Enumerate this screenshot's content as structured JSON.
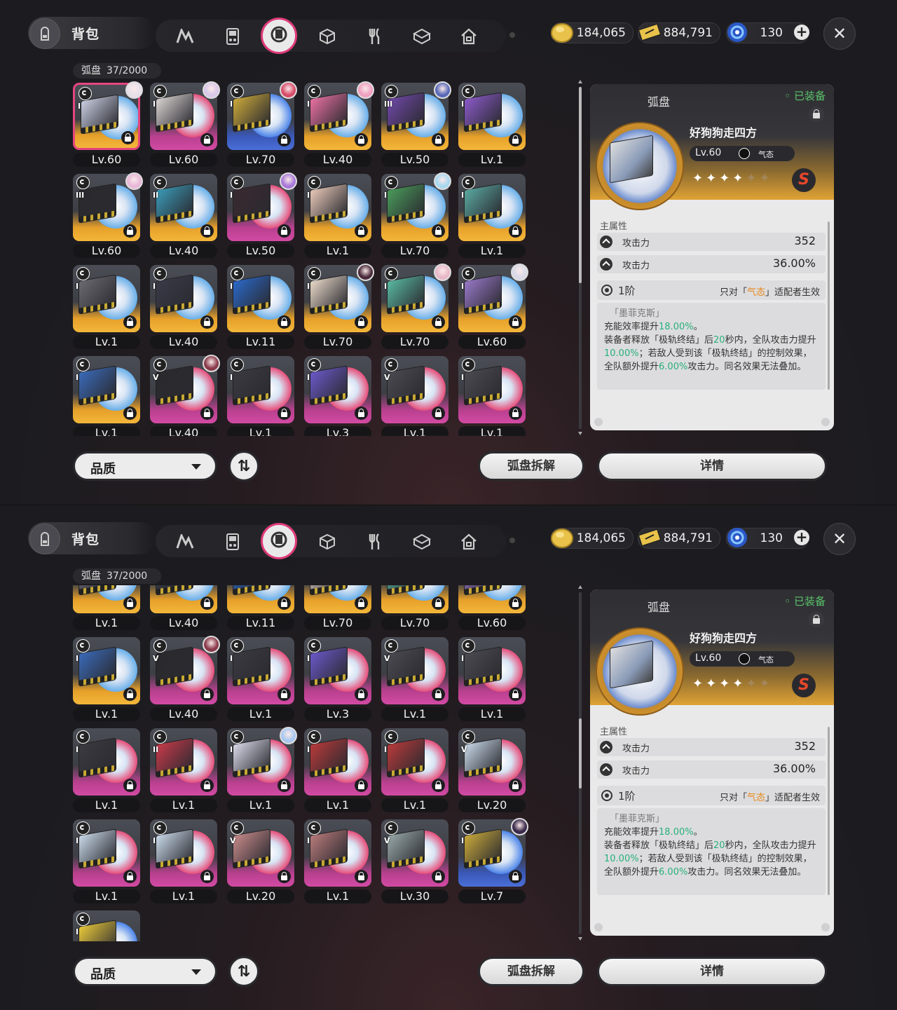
{
  "colors": {
    "selected_border": "#e5457f",
    "green": "#27b07a",
    "orange": "#e88a1a",
    "equipped": "#5ac26a"
  },
  "header": {
    "title": "背包",
    "nav_tabs": [
      "agents-icon",
      "gamepad-icon",
      "disc-icon",
      "cube-icon",
      "food-icon",
      "package-icon",
      "home-icon"
    ],
    "active_tab": "disc-icon",
    "currencies": [
      {
        "icon": "coin-icon",
        "value": "184,065"
      },
      {
        "icon": "ticket-icon",
        "value": "884,791"
      },
      {
        "icon": "energy-icon",
        "value": "130"
      }
    ]
  },
  "grid": {
    "label": "弧盘",
    "count": "37/2000"
  },
  "panel1": {
    "items": [
      {
        "lv": "Lv.60",
        "rank": "I",
        "rarity": "gold",
        "avatar": "#e8e0e8",
        "cover": "#c8cde0",
        "selected": true
      },
      {
        "lv": "Lv.60",
        "rank": "I",
        "rarity": "purple",
        "avatar": "#d8c8e8",
        "cover": "#d8d2d0"
      },
      {
        "lv": "Lv.70",
        "rank": "I",
        "rarity": "blue",
        "avatar": "#d84c6a",
        "cover": "#caa83a"
      },
      {
        "lv": "Lv.40",
        "rank": "I",
        "rarity": "gold",
        "avatar": "#f0a0c0",
        "cover": "#e870a0"
      },
      {
        "lv": "Lv.50",
        "rank": "III",
        "rarity": "gold",
        "avatar": "#5a6ab8",
        "cover": "#7048a8"
      },
      {
        "lv": "Lv.1",
        "rank": "I",
        "rarity": "gold",
        "avatar": "",
        "cover": "#8a5ac8"
      },
      {
        "lv": "Lv.60",
        "rank": "III",
        "rarity": "gold",
        "avatar": "#e8b8d8",
        "cover": "#2a2a2e"
      },
      {
        "lv": "Lv.40",
        "rank": "II",
        "rarity": "gold",
        "avatar": "",
        "cover": "#3a9ab8"
      },
      {
        "lv": "Lv.50",
        "rank": "I",
        "rarity": "purple",
        "avatar": "#a878d8",
        "cover": "#3a2a30"
      },
      {
        "lv": "Lv.1",
        "rank": "I",
        "rarity": "gold",
        "avatar": "",
        "cover": "#e8c8b8"
      },
      {
        "lv": "Lv.70",
        "rank": "I",
        "rarity": "gold",
        "avatar": "#a8d8f0",
        "cover": "#4a9a5a"
      },
      {
        "lv": "Lv.1",
        "rank": "I",
        "rarity": "gold",
        "avatar": "",
        "cover": "#5aa8a0"
      },
      {
        "lv": "Lv.1",
        "rank": "I",
        "rarity": "gold",
        "avatar": "",
        "cover": "#6a6a70"
      },
      {
        "lv": "Lv.40",
        "rank": "I",
        "rarity": "gold",
        "avatar": "",
        "cover": "#3a3a48"
      },
      {
        "lv": "Lv.11",
        "rank": "I",
        "rarity": "gold",
        "avatar": "",
        "cover": "#2a68c8"
      },
      {
        "lv": "Lv.70",
        "rank": "I",
        "rarity": "gold",
        "avatar": "#4a2a3a",
        "cover": "#e8d8c8"
      },
      {
        "lv": "Lv.70",
        "rank": "I",
        "rarity": "gold",
        "avatar": "#e8b8c8",
        "cover": "#58b8a0"
      },
      {
        "lv": "Lv.60",
        "rank": "I",
        "rarity": "gold",
        "avatar": "#d8d8e8",
        "cover": "#9878c8"
      },
      {
        "lv": "Lv.1",
        "rank": "I",
        "rarity": "gold",
        "avatar": "",
        "cover": "#3a6ab8"
      },
      {
        "lv": "Lv.40",
        "rank": "V",
        "rarity": "purple",
        "avatar": "#8a3a4a",
        "cover": "#2a2a2e"
      },
      {
        "lv": "Lv.1",
        "rank": "I",
        "rarity": "purple",
        "avatar": "",
        "cover": "#3a3a40"
      },
      {
        "lv": "Lv.3",
        "rank": "I",
        "rarity": "purple",
        "avatar": "",
        "cover": "#6a58c8"
      },
      {
        "lv": "Lv.1",
        "rank": "V",
        "rarity": "purple",
        "avatar": "",
        "cover": "#4a4a50"
      },
      {
        "lv": "Lv.1",
        "rank": "I",
        "rarity": "purple",
        "avatar": "",
        "cover": "#4a4a50"
      }
    ]
  },
  "panel2": {
    "items": [
      {
        "lv": "Lv.1",
        "rank": "I",
        "rarity": "gold",
        "avatar": "",
        "cover": "#6a6a70"
      },
      {
        "lv": "Lv.40",
        "rank": "I",
        "rarity": "gold",
        "avatar": "",
        "cover": "#3a3a48"
      },
      {
        "lv": "Lv.11",
        "rank": "I",
        "rarity": "gold",
        "avatar": "",
        "cover": "#2a68c8"
      },
      {
        "lv": "Lv.70",
        "rank": "I",
        "rarity": "gold",
        "avatar": "",
        "cover": "#e8d8c8"
      },
      {
        "lv": "Lv.70",
        "rank": "I",
        "rarity": "gold",
        "avatar": "",
        "cover": "#58b8a0"
      },
      {
        "lv": "Lv.60",
        "rank": "I",
        "rarity": "gold",
        "avatar": "",
        "cover": "#9878c8"
      },
      {
        "lv": "Lv.1",
        "rank": "I",
        "rarity": "gold",
        "avatar": "",
        "cover": "#3a6ab8"
      },
      {
        "lv": "Lv.40",
        "rank": "V",
        "rarity": "purple",
        "avatar": "#8a3a4a",
        "cover": "#2a2a2e"
      },
      {
        "lv": "Lv.1",
        "rank": "I",
        "rarity": "purple",
        "avatar": "",
        "cover": "#3a3a40"
      },
      {
        "lv": "Lv.3",
        "rank": "I",
        "rarity": "purple",
        "avatar": "",
        "cover": "#6a58c8"
      },
      {
        "lv": "Lv.1",
        "rank": "V",
        "rarity": "purple",
        "avatar": "",
        "cover": "#4a4a50"
      },
      {
        "lv": "Lv.1",
        "rank": "I",
        "rarity": "purple",
        "avatar": "",
        "cover": "#4a4a50"
      },
      {
        "lv": "Lv.1",
        "rank": "I",
        "rarity": "purple",
        "avatar": "",
        "cover": "#3a3a40"
      },
      {
        "lv": "Lv.1",
        "rank": "II",
        "rarity": "purple",
        "avatar": "",
        "cover": "#c83a4a"
      },
      {
        "lv": "Lv.1",
        "rank": "I",
        "rarity": "purple",
        "avatar": "#a8c8f0",
        "cover": "#d8d8e8"
      },
      {
        "lv": "Lv.1",
        "rank": "I",
        "rarity": "purple",
        "avatar": "",
        "cover": "#b83a3a"
      },
      {
        "lv": "Lv.1",
        "rank": "I",
        "rarity": "purple",
        "avatar": "",
        "cover": "#b83a3a"
      },
      {
        "lv": "Lv.20",
        "rank": "V",
        "rarity": "purple",
        "avatar": "",
        "cover": "#c8d8e8"
      },
      {
        "lv": "Lv.1",
        "rank": "I",
        "rarity": "purple",
        "avatar": "",
        "cover": "#c8d8e8"
      },
      {
        "lv": "Lv.1",
        "rank": "I",
        "rarity": "purple",
        "avatar": "",
        "cover": "#c8d8e8"
      },
      {
        "lv": "Lv.20",
        "rank": "V",
        "rarity": "purple",
        "avatar": "",
        "cover": "#c88a8a"
      },
      {
        "lv": "Lv.1",
        "rank": "I",
        "rarity": "purple",
        "avatar": "",
        "cover": "#b87a7a"
      },
      {
        "lv": "Lv.30",
        "rank": "V",
        "rarity": "purple",
        "avatar": "",
        "cover": "#98a8a8"
      },
      {
        "lv": "Lv.7",
        "rank": "I",
        "rarity": "blue",
        "avatar": "#3a2a4a",
        "cover": "#c8a83a"
      },
      {
        "lv": "",
        "rank": "I",
        "rarity": "blue",
        "avatar": "",
        "cover": "#e8c83a"
      }
    ]
  },
  "controls": {
    "quality_label": "品质",
    "dismantle_label": "弧盘拆解",
    "details_label": "详情"
  },
  "detail": {
    "category": "弧盘",
    "equipped": "已装备",
    "name": "好狗狗走四方",
    "level": "Lv.60",
    "attribute": "气态",
    "stars_filled": 4,
    "stars_total": 6,
    "tier_badge": "S",
    "main_attr_label": "主属性",
    "stats": [
      {
        "label": "攻击力",
        "value": "352"
      },
      {
        "label": "攻击力",
        "value": "36.00%"
      }
    ],
    "tier": "1阶",
    "restriction_prefix": "只对「",
    "restriction_attr": "气态",
    "restriction_suffix": "」适配者生效",
    "effect_name": "「墨菲克斯」",
    "line1_a": "充能效率提升",
    "line1_b": "18.00%",
    "line1_c": "。",
    "line2_a": "装备者释放「极轨终结」后",
    "line2_b": "20",
    "line2_c": "秒内，全队攻击力提升",
    "line2_d": "10.00%",
    "line2_e": "；若敌人受到该「极轨终结」的控制效果，全队额外提升",
    "line2_f": "6.00%",
    "line2_g": "攻击力。同名效果无法叠加。"
  }
}
